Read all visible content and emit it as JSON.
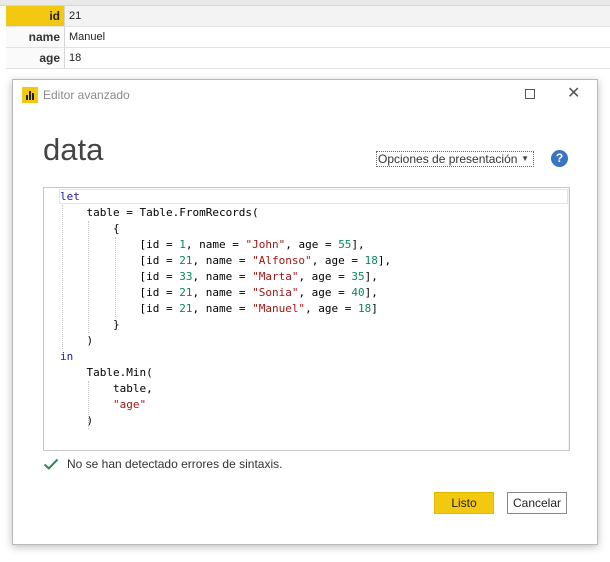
{
  "record": [
    {
      "key": "id",
      "value": "21",
      "selected": true
    },
    {
      "key": "name",
      "value": "Manuel"
    },
    {
      "key": "age",
      "value": "18"
    }
  ],
  "dialog": {
    "title": "Editor avanzado",
    "query_name": "data",
    "display_options_label": "Opciones de presentación",
    "help_label": "?",
    "status": "No se han detectado errores de sintaxis.",
    "done_label": "Listo",
    "cancel_label": "Cancelar",
    "icons": [
      "powerbi-app-icon",
      "maximize-icon",
      "close-icon",
      "help-icon",
      "checkmark-icon",
      "dropdown-caret-icon"
    ]
  },
  "code_lines": [
    "let",
    "    table = Table.FromRecords(",
    "        {",
    "            [id = 1, name = \"John\", age = 55],",
    "            [id = 21, name = \"Alfonso\", age = 18],",
    "            [id = 33, name = \"Marta\", age = 35],",
    "            [id = 21, name = \"Sonia\", age = 40],",
    "            [id = 21, name = \"Manuel\", age = 18]",
    "        }",
    "    )",
    "in",
    "    Table.Min(",
    "        table,",
    "        \"age\"",
    "    )"
  ],
  "colors": {
    "accent": "#f2c811",
    "keyword": "#1a1ab4",
    "string": "#a31515",
    "number": "#09885a",
    "check": "#2e8b57",
    "help": "#3a75c4"
  }
}
